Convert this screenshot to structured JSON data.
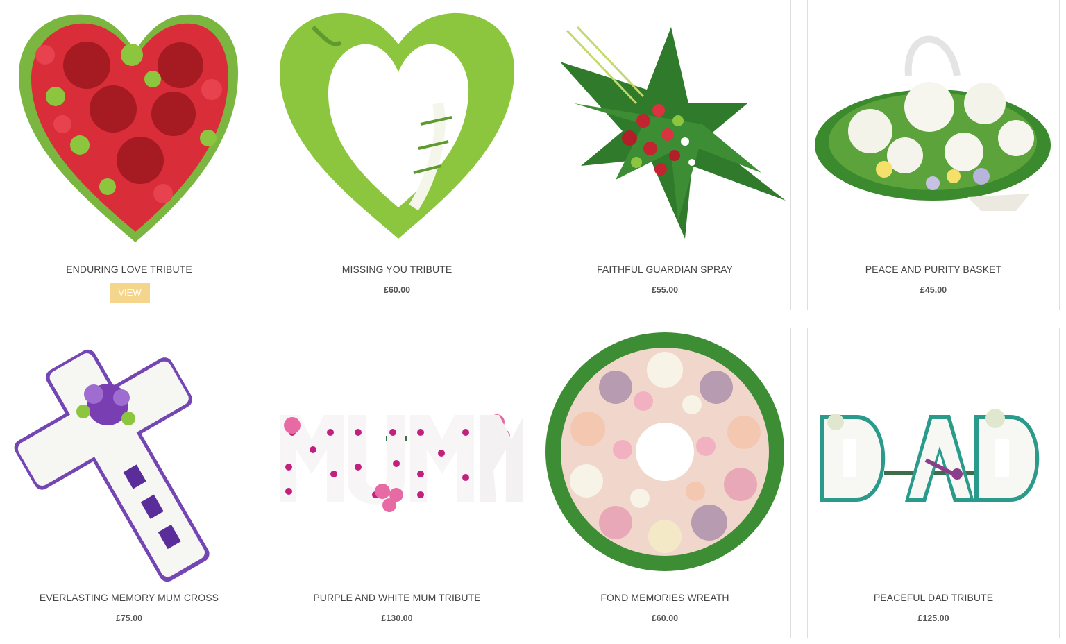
{
  "products": [
    {
      "title": "ENDURING LOVE TRIBUTE",
      "price": "",
      "button": "VIEW"
    },
    {
      "title": "MISSING YOU TRIBUTE",
      "price": "£60.00"
    },
    {
      "title": "FAITHFUL GUARDIAN SPRAY",
      "price": "£55.00"
    },
    {
      "title": "PEACE AND PURITY BASKET",
      "price": "£45.00"
    },
    {
      "title": "EVERLASTING MEMORY MUM CROSS",
      "price": "£75.00"
    },
    {
      "title": "PURPLE AND WHITE MUM TRIBUTE",
      "price": "£130.00"
    },
    {
      "title": "FOND MEMORIES WREATH",
      "price": "£60.00"
    },
    {
      "title": "PEACEFUL DAD TRIBUTE",
      "price": "£125.00"
    }
  ],
  "colors": {
    "view_button": "#f5d58c",
    "card_border": "#dedede",
    "title_text": "#444444"
  }
}
